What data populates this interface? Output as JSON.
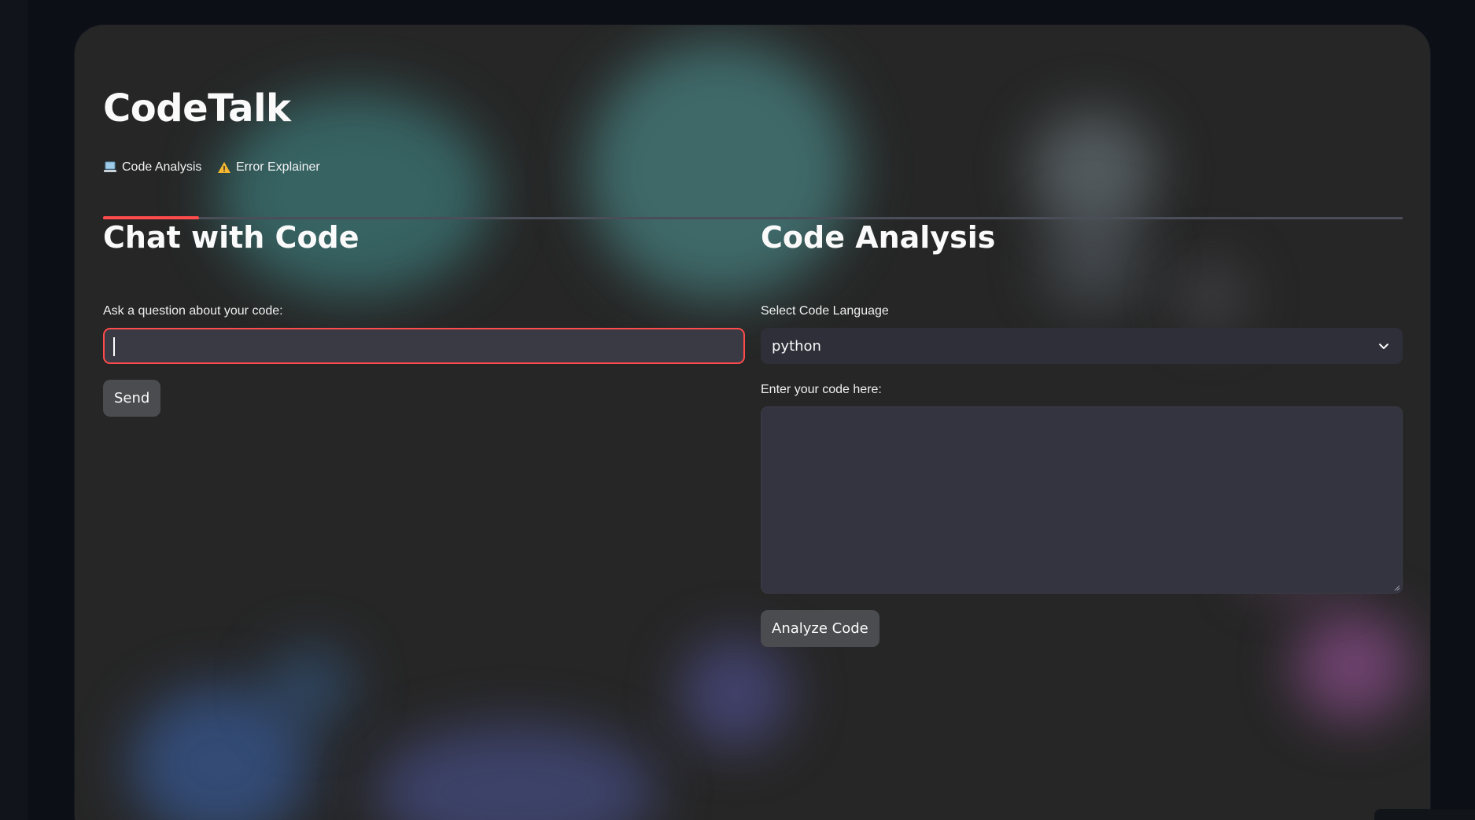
{
  "app": {
    "title": "CodeTalk"
  },
  "tabs": [
    {
      "label": "Code Analysis",
      "icon": "laptop-icon",
      "active": true
    },
    {
      "label": "Error Explainer",
      "icon": "warning-icon",
      "active": false
    }
  ],
  "chat": {
    "heading": "Chat with Code",
    "question_label": "Ask a question about your code:",
    "question_value": "",
    "send_label": "Send"
  },
  "analysis": {
    "heading": "Code Analysis",
    "language_label": "Select Code Language",
    "language_value": "python",
    "code_label": "Enter your code here:",
    "code_value": "",
    "analyze_label": "Analyze Code"
  },
  "colors": {
    "accent": "#ff4b4b",
    "card": "#262626",
    "input_bg": "#3a3a44",
    "button_bg": "#4b4c50"
  }
}
